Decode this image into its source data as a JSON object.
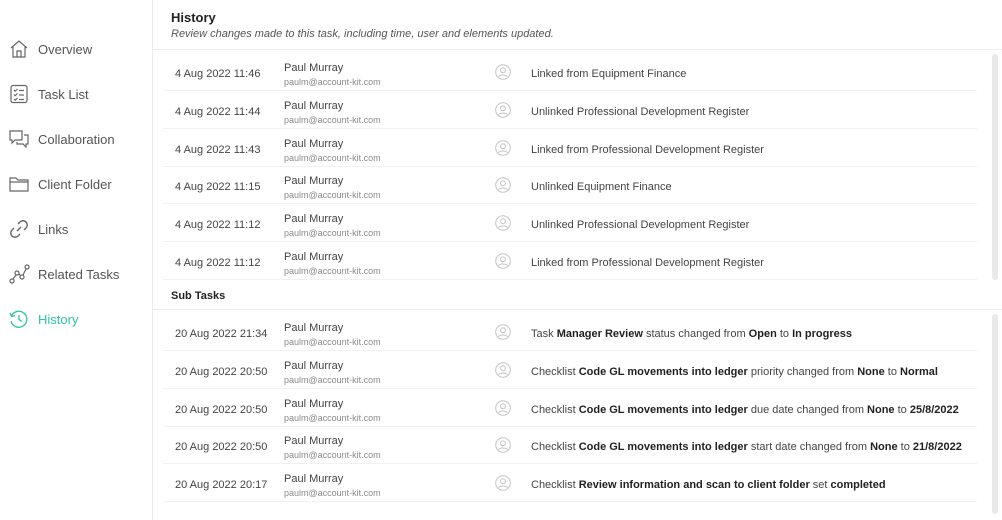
{
  "nav": [
    {
      "label": "Overview",
      "icon": "home-icon",
      "active": false
    },
    {
      "label": "Task List",
      "icon": "checklist-icon",
      "active": false
    },
    {
      "label": "Collaboration",
      "icon": "chat-icon",
      "active": false
    },
    {
      "label": "Client Folder",
      "icon": "folder-icon",
      "active": false
    },
    {
      "label": "Links",
      "icon": "link-icon",
      "active": false
    },
    {
      "label": "Related Tasks",
      "icon": "graph-icon",
      "active": false
    },
    {
      "label": "History",
      "icon": "clock-history-icon",
      "active": true
    }
  ],
  "header": {
    "title": "History",
    "subtitle": "Review changes made to this task, including time, user and elements updated."
  },
  "history": [
    {
      "date": "4 Aug 2022 11:46",
      "user": "Paul Murray",
      "email": "paulm@account-kit.com",
      "parts": [
        {
          "t": "Linked from Equipment Finance",
          "b": false
        }
      ]
    },
    {
      "date": "4 Aug 2022 11:44",
      "user": "Paul Murray",
      "email": "paulm@account-kit.com",
      "parts": [
        {
          "t": "Unlinked Professional Development Register",
          "b": false
        }
      ]
    },
    {
      "date": "4 Aug 2022 11:43",
      "user": "Paul Murray",
      "email": "paulm@account-kit.com",
      "parts": [
        {
          "t": "Linked from Professional Development Register",
          "b": false
        }
      ]
    },
    {
      "date": "4 Aug 2022 11:15",
      "user": "Paul Murray",
      "email": "paulm@account-kit.com",
      "parts": [
        {
          "t": "Unlinked Equipment Finance",
          "b": false
        }
      ]
    },
    {
      "date": "4 Aug 2022 11:12",
      "user": "Paul Murray",
      "email": "paulm@account-kit.com",
      "parts": [
        {
          "t": "Unlinked Professional Development Register",
          "b": false
        }
      ]
    },
    {
      "date": "4 Aug 2022 11:12",
      "user": "Paul Murray",
      "email": "paulm@account-kit.com",
      "parts": [
        {
          "t": "Linked from Professional Development Register",
          "b": false
        }
      ]
    }
  ],
  "subtasks_title": "Sub Tasks",
  "subtasks": [
    {
      "date": "20 Aug 2022 21:34",
      "user": "Paul Murray",
      "email": "paulm@account-kit.com",
      "parts": [
        {
          "t": "Task ",
          "b": false
        },
        {
          "t": "Manager Review",
          "b": true
        },
        {
          "t": " status changed from ",
          "b": false
        },
        {
          "t": "Open",
          "b": true
        },
        {
          "t": " to ",
          "b": false
        },
        {
          "t": "In progress",
          "b": true
        }
      ]
    },
    {
      "date": "20 Aug 2022 20:50",
      "user": "Paul Murray",
      "email": "paulm@account-kit.com",
      "parts": [
        {
          "t": "Checklist ",
          "b": false
        },
        {
          "t": "Code GL movements into ledger",
          "b": true
        },
        {
          "t": " priority changed from ",
          "b": false
        },
        {
          "t": "None",
          "b": true
        },
        {
          "t": " to ",
          "b": false
        },
        {
          "t": "Normal",
          "b": true
        }
      ]
    },
    {
      "date": "20 Aug 2022 20:50",
      "user": "Paul Murray",
      "email": "paulm@account-kit.com",
      "parts": [
        {
          "t": "Checklist ",
          "b": false
        },
        {
          "t": "Code GL movements into ledger",
          "b": true
        },
        {
          "t": " due date changed from ",
          "b": false
        },
        {
          "t": "None",
          "b": true
        },
        {
          "t": " to ",
          "b": false
        },
        {
          "t": "25/8/2022",
          "b": true
        }
      ]
    },
    {
      "date": "20 Aug 2022 20:50",
      "user": "Paul Murray",
      "email": "paulm@account-kit.com",
      "parts": [
        {
          "t": "Checklist ",
          "b": false
        },
        {
          "t": "Code GL movements into ledger",
          "b": true
        },
        {
          "t": " start date changed from ",
          "b": false
        },
        {
          "t": "None",
          "b": true
        },
        {
          "t": " to ",
          "b": false
        },
        {
          "t": "21/8/2022",
          "b": true
        }
      ]
    },
    {
      "date": "20 Aug 2022 20:17",
      "user": "Paul Murray",
      "email": "paulm@account-kit.com",
      "parts": [
        {
          "t": "Checklist ",
          "b": false
        },
        {
          "t": "Review information and scan to client folder",
          "b": true
        },
        {
          "t": " set ",
          "b": false
        },
        {
          "t": "completed",
          "b": true
        }
      ]
    }
  ],
  "colors": {
    "accent": "#2ec4a7",
    "text": "#444444",
    "muted": "#8a8a8a"
  }
}
